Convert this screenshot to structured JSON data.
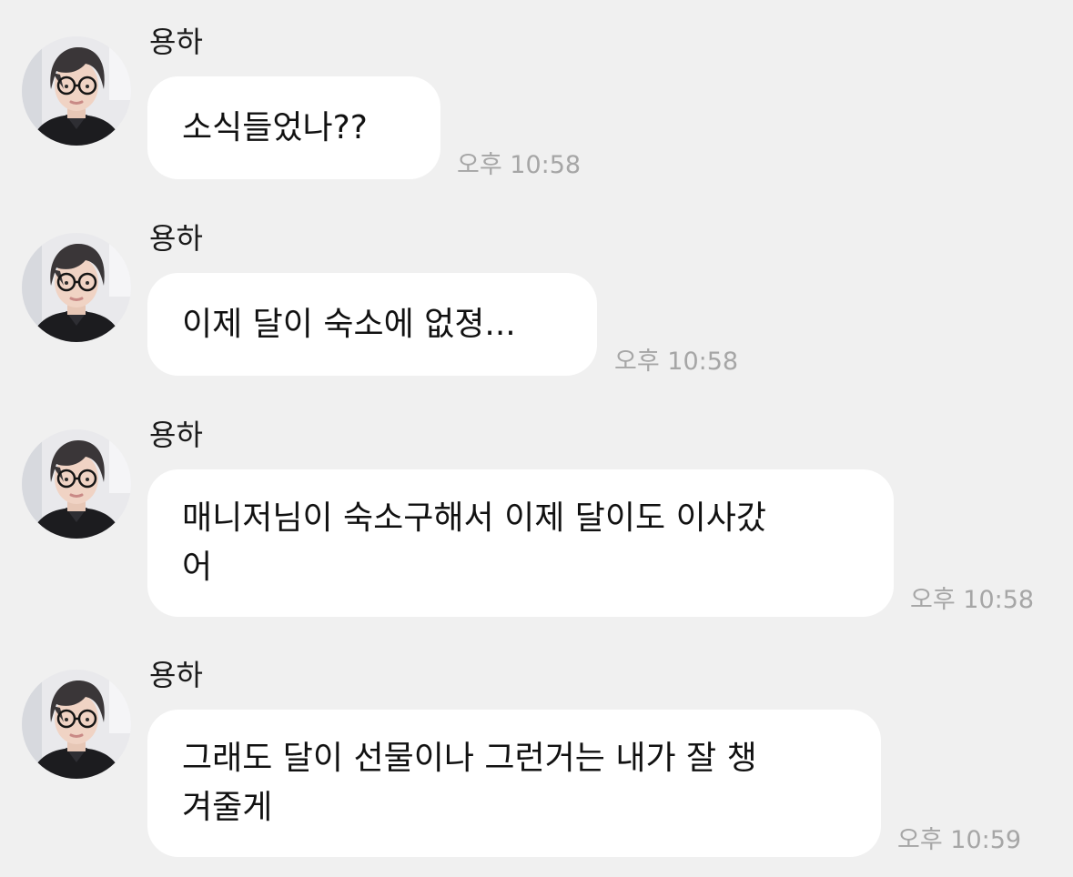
{
  "messages": [
    {
      "sender": "용하",
      "text": "소식들었나??",
      "time": "오후 10:58"
    },
    {
      "sender": "용하",
      "text": "이제 달이 숙소에 없졍...",
      "time": "오후 10:58"
    },
    {
      "sender": "용하",
      "text": "매니저님이 숙소구해서 이제 달이도 이사갔\n어",
      "time": "오후 10:58"
    },
    {
      "sender": "용하",
      "text": "그래도 달이 선물이나 그런거는 내가 잘 챙\n겨줄게",
      "time": "오후 10:59"
    }
  ]
}
